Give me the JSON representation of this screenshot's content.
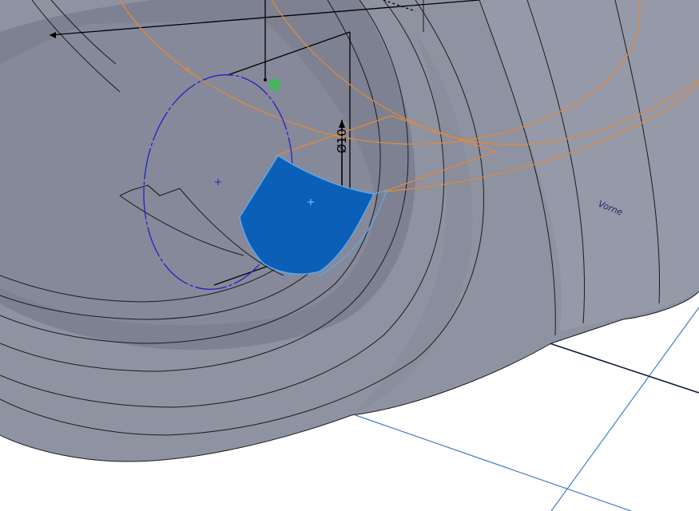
{
  "viewport": {
    "background": "#ffffff",
    "part_color": "#8f92a1",
    "part_dark": "#7d8090",
    "part_light": "#a3a6b4",
    "edge_color": "#1a1a1f",
    "floor_grid_color": "#3e7fc7",
    "floor_axis_color": "#0d1b3e"
  },
  "sketch": {
    "ellipse_color": "#1e22c8",
    "reference_curve_color": "#e08a3a",
    "selected_face_color": "#0b5fb6",
    "selected_face_edge": "#5ea8ec",
    "endpoint_marker_color": "#27c93f"
  },
  "dimension": {
    "label": "Ø10",
    "color": "#000000"
  },
  "engraving": {
    "text": "Vorne"
  },
  "icons": {
    "endpoint_marker": "sketch-point-icon",
    "center_mark": "center-point-icon"
  }
}
